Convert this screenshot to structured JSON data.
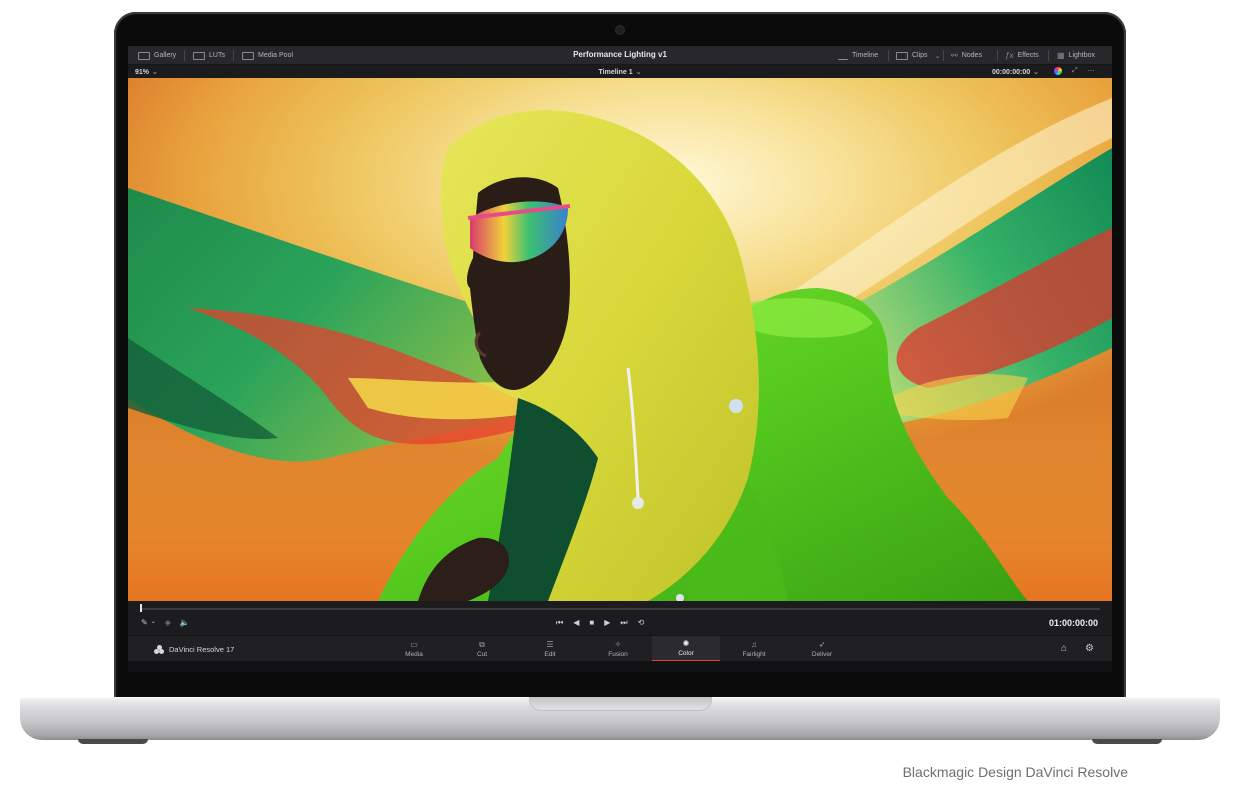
{
  "topbar": {
    "left_items": [
      {
        "label": "Gallery",
        "icon": "gallery-icon"
      },
      {
        "label": "LUTs",
        "icon": "luts-icon"
      },
      {
        "label": "Media Pool",
        "icon": "media-pool-icon"
      }
    ],
    "project_title": "Performance Lighting v1",
    "right_items": [
      {
        "label": "Timeline",
        "icon": "timeline-icon"
      },
      {
        "label": "Clips",
        "icon": "clips-icon"
      },
      {
        "label": "Nodes",
        "icon": "nodes-icon"
      },
      {
        "label": "Effects",
        "icon": "effects-icon"
      },
      {
        "label": "Lightbox",
        "icon": "lightbox-icon"
      }
    ]
  },
  "viewer_bar": {
    "zoom": "91%",
    "timeline_name": "Timeline 1",
    "timecode": "00:00:00:00"
  },
  "transport": {
    "timecode": "01:00:00:00"
  },
  "pages": [
    {
      "label": "Media",
      "icon": "media-page-icon",
      "active": false
    },
    {
      "label": "Cut",
      "icon": "cut-page-icon",
      "active": false
    },
    {
      "label": "Edit",
      "icon": "edit-page-icon",
      "active": false
    },
    {
      "label": "Fusion",
      "icon": "fusion-page-icon",
      "active": false
    },
    {
      "label": "Color",
      "icon": "color-page-icon",
      "active": true
    },
    {
      "label": "Fairlight",
      "icon": "fairlight-page-icon",
      "active": false
    },
    {
      "label": "Deliver",
      "icon": "deliver-page-icon",
      "active": false
    }
  ],
  "app_name": "DaVinci Resolve 17",
  "caption": "Blackmagic Design DaVinci Resolve",
  "colors": {
    "active_page_underline": "#e2403a",
    "ui_background": "#1c1c1f"
  }
}
